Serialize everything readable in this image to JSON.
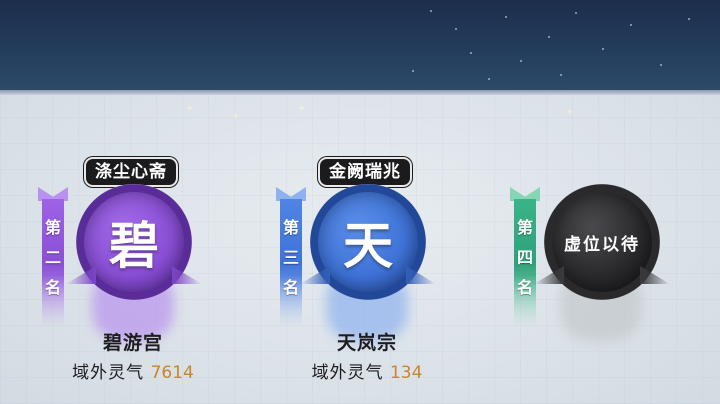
{
  "rankings": [
    {
      "title": "涤尘心斋",
      "rank_chars": [
        "第",
        "二",
        "名"
      ],
      "emblem_char": "碧",
      "sect_name": "碧游宫",
      "qi_label": "域外灵气",
      "qi_value": "7614",
      "theme": {
        "main": "#8a4fd6",
        "light": "#b892ee",
        "dark": "#5a2c9a"
      }
    },
    {
      "title": "金阙瑞兆",
      "rank_chars": [
        "第",
        "三",
        "名"
      ],
      "emblem_char": "天",
      "sect_name": "天岚宗",
      "qi_label": "域外灵气",
      "qi_value": "134",
      "theme": {
        "main": "#3f73d8",
        "light": "#8fb2ef",
        "dark": "#22489a"
      }
    },
    {
      "rank_chars": [
        "第",
        "四",
        "名"
      ],
      "vacant_text": "虚位以待",
      "theme": {
        "main": "#2fa27a",
        "light": "#86d5b5",
        "dark": "#1b6e51"
      }
    }
  ],
  "colors": {
    "qi_value": "#c7862a",
    "title_bg": "#1b1b1d",
    "vacant_emblem": "#2a2a2c"
  },
  "icons": {
    "banner": "rank-banner-icon",
    "emblem": "sect-emblem-icon"
  }
}
